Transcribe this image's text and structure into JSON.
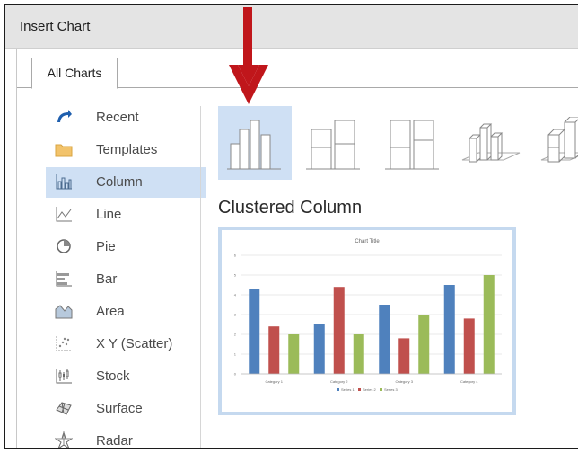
{
  "window": {
    "title": "Insert Chart"
  },
  "tabs": [
    {
      "label": "All Charts"
    }
  ],
  "categories": [
    {
      "label": "Recent",
      "icon": "recent-icon"
    },
    {
      "label": "Templates",
      "icon": "folder-icon"
    },
    {
      "label": "Column",
      "icon": "column-chart-icon",
      "selected": true
    },
    {
      "label": "Line",
      "icon": "line-chart-icon"
    },
    {
      "label": "Pie",
      "icon": "pie-chart-icon"
    },
    {
      "label": "Bar",
      "icon": "bar-chart-icon"
    },
    {
      "label": "Area",
      "icon": "area-chart-icon"
    },
    {
      "label": "X Y (Scatter)",
      "icon": "scatter-chart-icon"
    },
    {
      "label": "Stock",
      "icon": "stock-chart-icon"
    },
    {
      "label": "Surface",
      "icon": "surface-chart-icon"
    },
    {
      "label": "Radar",
      "icon": "radar-chart-icon"
    }
  ],
  "subtype_heading": "Clustered Column",
  "colors": {
    "selection": "#cfe0f4",
    "arrow": "#c0161b",
    "series1": "#4f81bd",
    "series2": "#c0504d",
    "series3": "#9bbb59"
  },
  "chart_data": {
    "type": "bar",
    "title": "Chart Title",
    "categories": [
      "Category 1",
      "Category 2",
      "Category 3",
      "Category 4"
    ],
    "series": [
      {
        "name": "Series 1",
        "values": [
          4.3,
          2.5,
          3.5,
          4.5
        ]
      },
      {
        "name": "Series 2",
        "values": [
          2.4,
          4.4,
          1.8,
          2.8
        ]
      },
      {
        "name": "Series 3",
        "values": [
          2.0,
          2.0,
          3.0,
          5.0
        ]
      }
    ],
    "ylim": [
      0,
      6
    ],
    "y_ticks": [
      "0",
      "1",
      "2",
      "3",
      "4",
      "5",
      "6"
    ],
    "grid": true,
    "legend": "bottom"
  }
}
